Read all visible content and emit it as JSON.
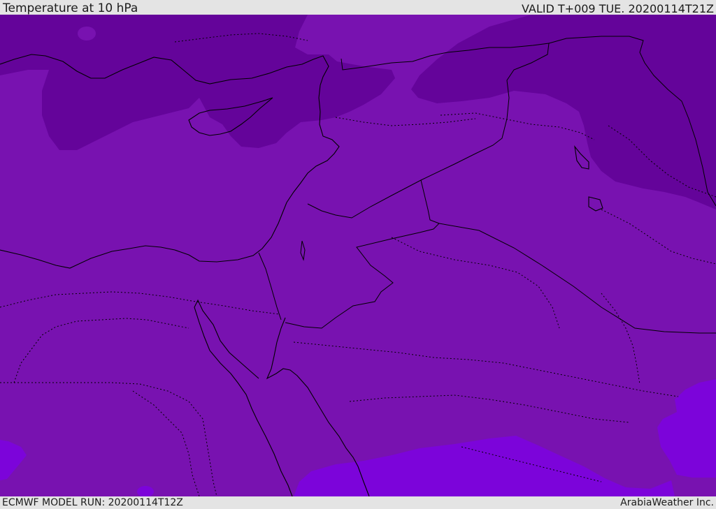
{
  "header": {
    "title": "Temperature at 10 hPa",
    "valid_time": "VALID T+009 TUE. 20200114T21Z"
  },
  "footer": {
    "model_run": "ECMWF MODEL RUN: 20200114T12Z",
    "credit": "ArabiaWeather Inc."
  },
  "colors": {
    "frame_background": "#e4e4e4",
    "field_base": "#7812b0",
    "field_dark": "#64049a",
    "field_light": "#7c04da",
    "coastline": "#000000",
    "borders": "#000000"
  }
}
